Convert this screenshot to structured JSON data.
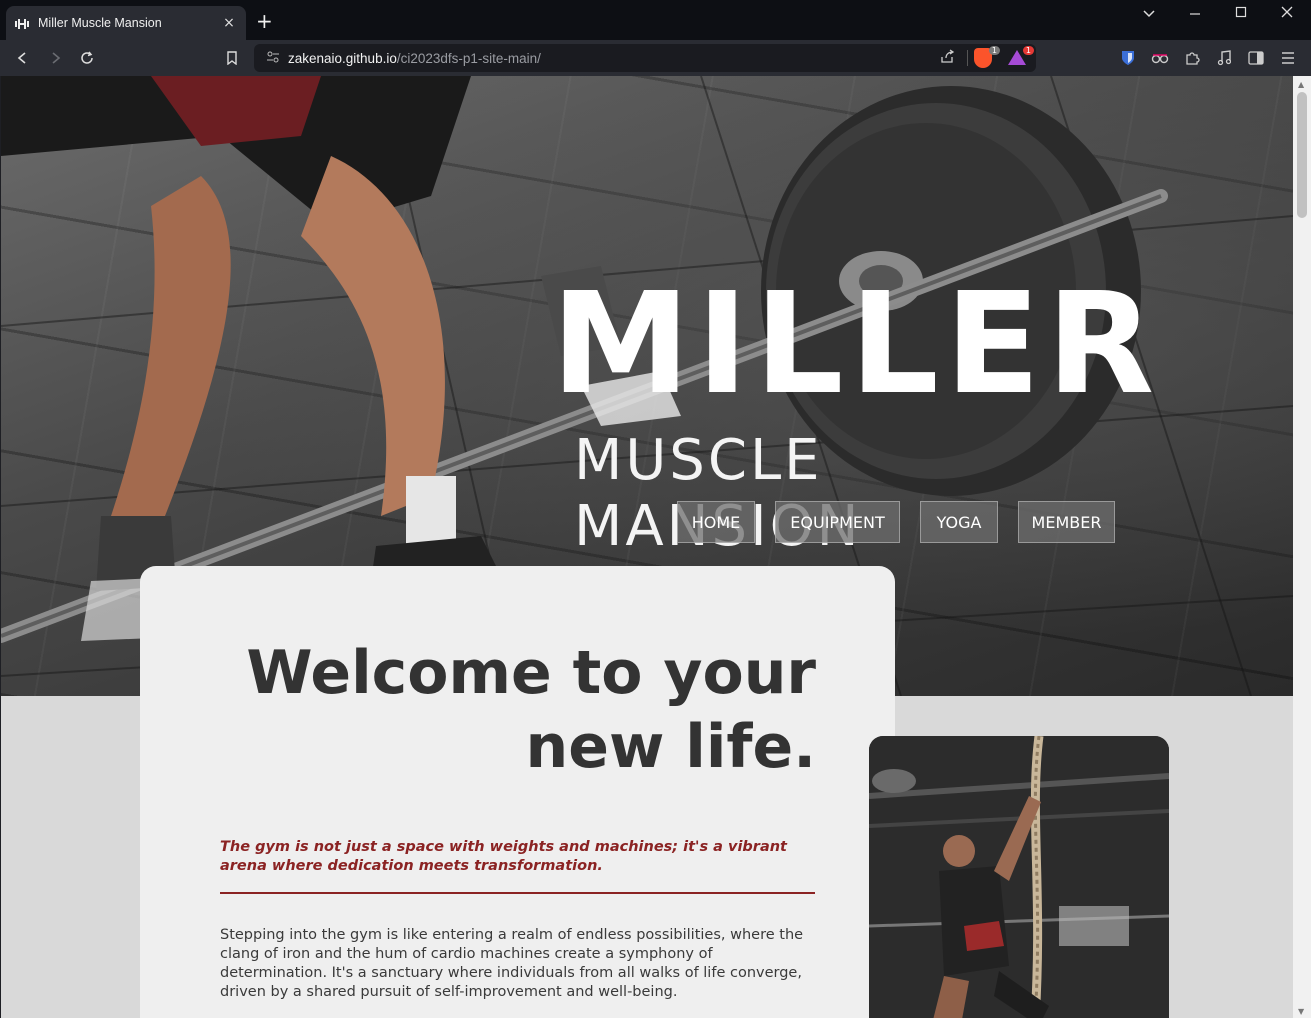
{
  "browser": {
    "tab_title": "Miller Muscle Mansion",
    "tab_close": "×",
    "new_tab": "+",
    "url_host": "zakenaio.github.io",
    "url_path": "/ci2023dfs-p1-site-main/",
    "brave_badge": "1",
    "rewards_badge": "1"
  },
  "site": {
    "brand_title": "MILLER",
    "brand_subtitle": "MUSCLE MANSION",
    "nav": [
      "HOME",
      "EQUIPMENT",
      "YOGA",
      "MEMBER"
    ]
  },
  "main": {
    "heading": "Welcome to your new life.",
    "tagline": "The gym is not just a space with weights and machines; it's a vibrant arena where dedication meets transformation.",
    "body": "Stepping into the gym is like entering a realm of endless possibilities, where the clang of iron and the hum of cardio machines create a symphony of determination. It's a sanctuary where individuals from all walks of life converge, driven by a shared pursuit of self-improvement and well-being."
  },
  "colors": {
    "accent": "#8b2323",
    "heading": "#333333",
    "card": "#efefef",
    "page_bg": "#d9d9d9"
  },
  "icons": [
    "back-icon",
    "forward-icon",
    "reload-icon",
    "bookmark-icon",
    "site-info-icon",
    "share-icon",
    "brave-shields-icon",
    "brave-rewards-icon",
    "bitwarden-icon",
    "extension-icon",
    "puzzle-icon",
    "media-icon",
    "sidebar-icon",
    "menu-icon"
  ]
}
